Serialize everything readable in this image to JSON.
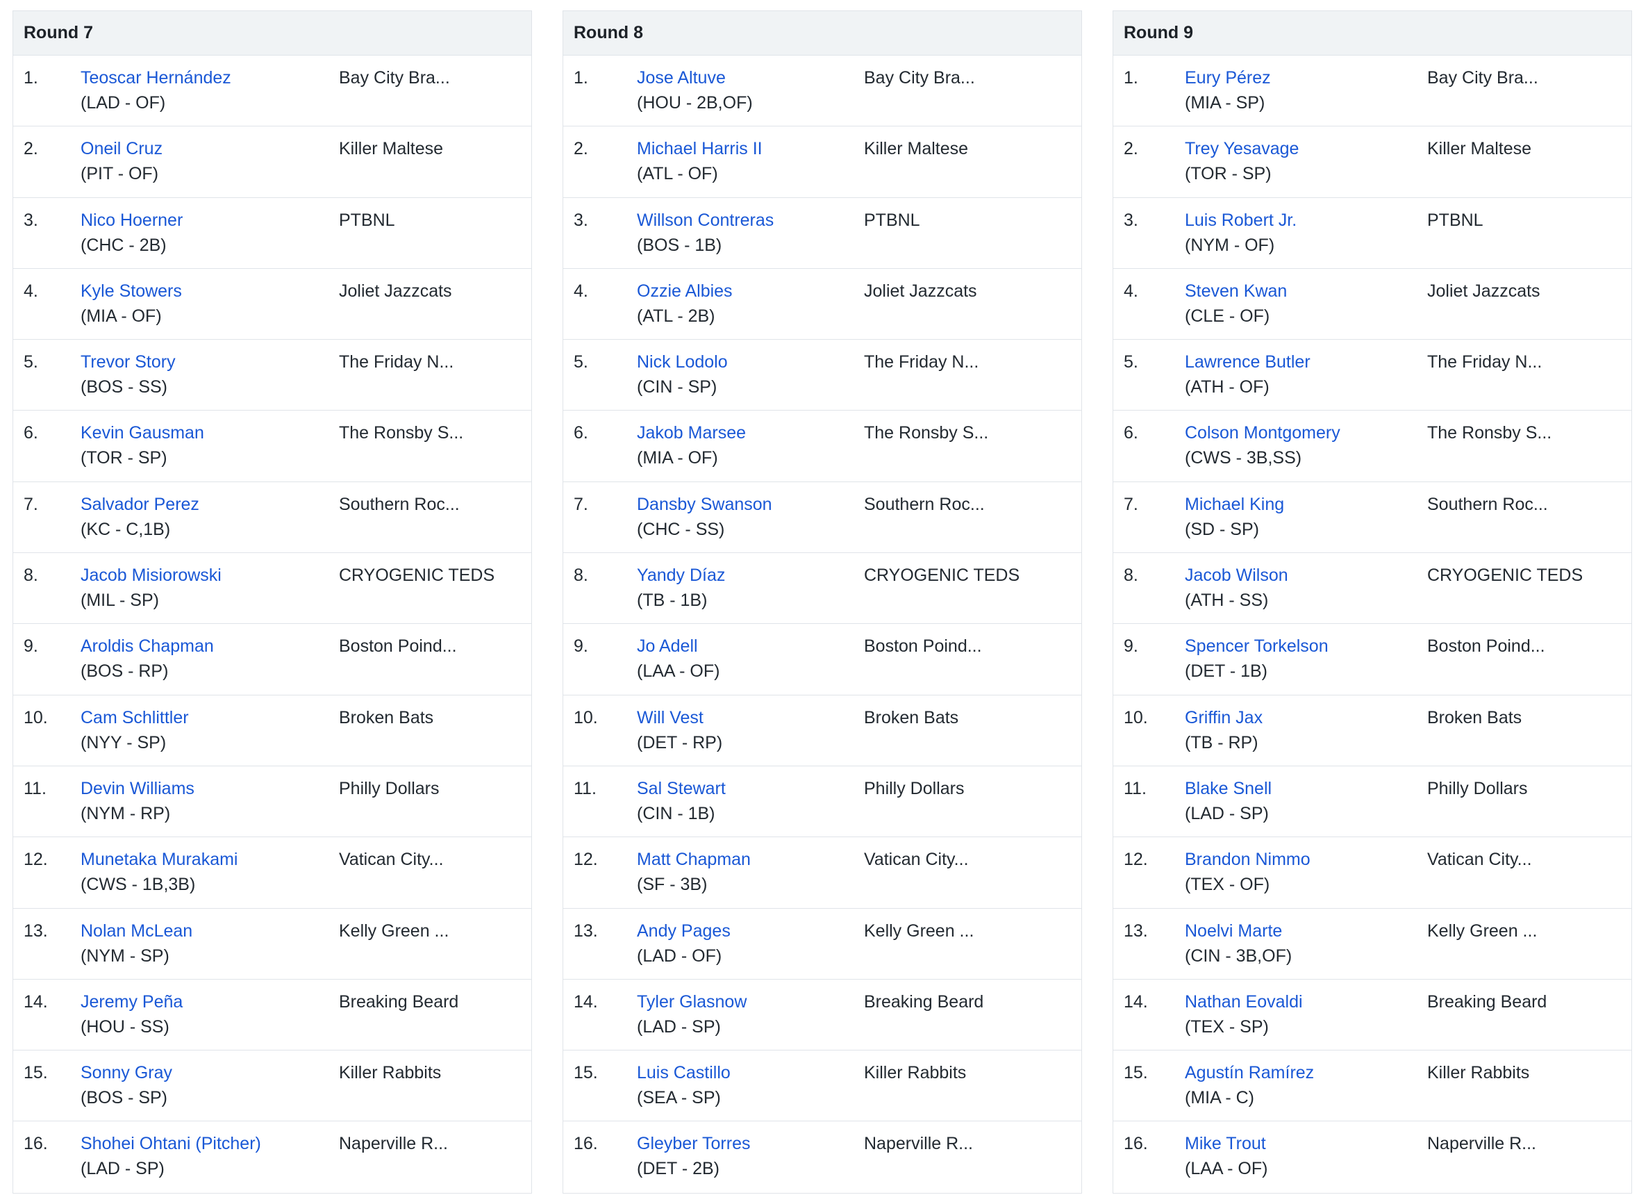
{
  "rounds": [
    {
      "title": "Round 7",
      "picks": [
        {
          "num": "1.",
          "player": "Teoscar Hernández",
          "info": "(LAD - OF)",
          "team": "Bay City Bra..."
        },
        {
          "num": "2.",
          "player": "Oneil Cruz",
          "info": "(PIT - OF)",
          "team": "Killer Maltese"
        },
        {
          "num": "3.",
          "player": "Nico Hoerner",
          "info": "(CHC - 2B)",
          "team": "PTBNL"
        },
        {
          "num": "4.",
          "player": "Kyle Stowers",
          "info": "(MIA - OF)",
          "team": "Joliet Jazzcats"
        },
        {
          "num": "5.",
          "player": "Trevor Story",
          "info": "(BOS - SS)",
          "team": "The Friday N..."
        },
        {
          "num": "6.",
          "player": "Kevin Gausman",
          "info": "(TOR - SP)",
          "team": "The Ronsby S..."
        },
        {
          "num": "7.",
          "player": "Salvador Perez",
          "info": "(KC - C,1B)",
          "team": "Southern Roc..."
        },
        {
          "num": "8.",
          "player": "Jacob Misiorowski",
          "info": "(MIL - SP)",
          "team": "CRYOGENIC TEDS"
        },
        {
          "num": "9.",
          "player": "Aroldis Chapman",
          "info": "(BOS - RP)",
          "team": "Boston Poind..."
        },
        {
          "num": "10.",
          "player": "Cam Schlittler",
          "info": "(NYY - SP)",
          "team": "Broken Bats"
        },
        {
          "num": "11.",
          "player": "Devin Williams",
          "info": "(NYM - RP)",
          "team": "Philly Dollars"
        },
        {
          "num": "12.",
          "player": "Munetaka Murakami",
          "info": "(CWS - 1B,3B)",
          "team": "Vatican City..."
        },
        {
          "num": "13.",
          "player": "Nolan McLean",
          "info": "(NYM - SP)",
          "team": "Kelly Green ..."
        },
        {
          "num": "14.",
          "player": "Jeremy Peña",
          "info": "(HOU - SS)",
          "team": "Breaking Beard"
        },
        {
          "num": "15.",
          "player": "Sonny Gray",
          "info": "(BOS - SP)",
          "team": "Killer Rabbits"
        },
        {
          "num": "16.",
          "player": "Shohei Ohtani (Pitcher)",
          "info": "(LAD - SP)",
          "team": "Naperville R..."
        }
      ]
    },
    {
      "title": "Round 8",
      "picks": [
        {
          "num": "1.",
          "player": "Jose Altuve",
          "info": "(HOU - 2B,OF)",
          "team": "Bay City Bra..."
        },
        {
          "num": "2.",
          "player": "Michael Harris II",
          "info": "(ATL - OF)",
          "team": "Killer Maltese"
        },
        {
          "num": "3.",
          "player": "Willson Contreras",
          "info": "(BOS - 1B)",
          "team": "PTBNL"
        },
        {
          "num": "4.",
          "player": "Ozzie Albies",
          "info": "(ATL - 2B)",
          "team": "Joliet Jazzcats"
        },
        {
          "num": "5.",
          "player": "Nick Lodolo",
          "info": "(CIN - SP)",
          "team": "The Friday N..."
        },
        {
          "num": "6.",
          "player": "Jakob Marsee",
          "info": "(MIA - OF)",
          "team": "The Ronsby S..."
        },
        {
          "num": "7.",
          "player": "Dansby Swanson",
          "info": "(CHC - SS)",
          "team": "Southern Roc..."
        },
        {
          "num": "8.",
          "player": "Yandy Díaz",
          "info": "(TB - 1B)",
          "team": "CRYOGENIC TEDS"
        },
        {
          "num": "9.",
          "player": "Jo Adell",
          "info": "(LAA - OF)",
          "team": "Boston Poind..."
        },
        {
          "num": "10.",
          "player": "Will Vest",
          "info": "(DET - RP)",
          "team": "Broken Bats"
        },
        {
          "num": "11.",
          "player": "Sal Stewart",
          "info": "(CIN - 1B)",
          "team": "Philly Dollars"
        },
        {
          "num": "12.",
          "player": "Matt Chapman",
          "info": "(SF - 3B)",
          "team": "Vatican City..."
        },
        {
          "num": "13.",
          "player": "Andy Pages",
          "info": "(LAD - OF)",
          "team": "Kelly Green ..."
        },
        {
          "num": "14.",
          "player": "Tyler Glasnow",
          "info": "(LAD - SP)",
          "team": "Breaking Beard"
        },
        {
          "num": "15.",
          "player": "Luis Castillo",
          "info": "(SEA - SP)",
          "team": "Killer Rabbits"
        },
        {
          "num": "16.",
          "player": "Gleyber Torres",
          "info": "(DET - 2B)",
          "team": "Naperville R..."
        }
      ]
    },
    {
      "title": "Round 9",
      "picks": [
        {
          "num": "1.",
          "player": "Eury Pérez",
          "info": "(MIA - SP)",
          "team": "Bay City Bra..."
        },
        {
          "num": "2.",
          "player": "Trey Yesavage",
          "info": "(TOR - SP)",
          "team": "Killer Maltese"
        },
        {
          "num": "3.",
          "player": "Luis Robert Jr.",
          "info": "(NYM - OF)",
          "team": "PTBNL"
        },
        {
          "num": "4.",
          "player": "Steven Kwan",
          "info": "(CLE - OF)",
          "team": "Joliet Jazzcats"
        },
        {
          "num": "5.",
          "player": "Lawrence Butler",
          "info": "(ATH - OF)",
          "team": "The Friday N..."
        },
        {
          "num": "6.",
          "player": "Colson Montgomery",
          "info": "(CWS - 3B,SS)",
          "team": "The Ronsby S..."
        },
        {
          "num": "7.",
          "player": "Michael King",
          "info": "(SD - SP)",
          "team": "Southern Roc..."
        },
        {
          "num": "8.",
          "player": "Jacob Wilson",
          "info": "(ATH - SS)",
          "team": "CRYOGENIC TEDS"
        },
        {
          "num": "9.",
          "player": "Spencer Torkelson",
          "info": "(DET - 1B)",
          "team": "Boston Poind..."
        },
        {
          "num": "10.",
          "player": "Griffin Jax",
          "info": "(TB - RP)",
          "team": "Broken Bats"
        },
        {
          "num": "11.",
          "player": "Blake Snell",
          "info": "(LAD - SP)",
          "team": "Philly Dollars"
        },
        {
          "num": "12.",
          "player": "Brandon Nimmo",
          "info": "(TEX - OF)",
          "team": "Vatican City..."
        },
        {
          "num": "13.",
          "player": "Noelvi Marte",
          "info": "(CIN - 3B,OF)",
          "team": "Kelly Green ..."
        },
        {
          "num": "14.",
          "player": "Nathan Eovaldi",
          "info": "(TEX - SP)",
          "team": "Breaking Beard"
        },
        {
          "num": "15.",
          "player": "Agustín Ramírez",
          "info": "(MIA - C)",
          "team": "Killer Rabbits"
        },
        {
          "num": "16.",
          "player": "Mike Trout",
          "info": "(LAA - OF)",
          "team": "Naperville R..."
        }
      ]
    }
  ],
  "colors": {
    "link": "#1a58d6",
    "text": "#232a31",
    "header_bg": "#f0f3f5",
    "border": "#e0e4e9"
  }
}
